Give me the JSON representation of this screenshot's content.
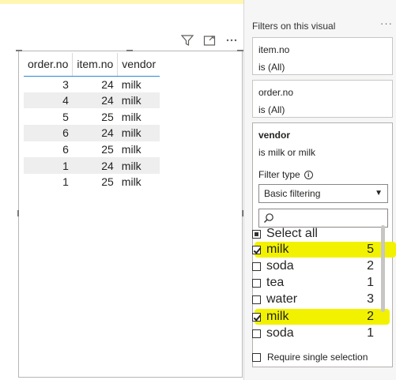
{
  "table": {
    "headers": [
      "order.no",
      "item.no",
      "vendor"
    ],
    "rows": [
      [
        "3",
        "24",
        "milk"
      ],
      [
        "4",
        "24",
        "milk"
      ],
      [
        "5",
        "25",
        "milk"
      ],
      [
        "6",
        "24",
        "milk"
      ],
      [
        "6",
        "25",
        "milk"
      ],
      [
        "1",
        "24",
        "milk"
      ],
      [
        "1",
        "25",
        "milk"
      ]
    ]
  },
  "visual_header": {
    "icons": [
      "filter-icon",
      "focus-mode-icon",
      "more-options-icon"
    ]
  },
  "filter_pane": {
    "title": "Filters on this visual",
    "more": "···",
    "cards": [
      {
        "field": "item.no",
        "summary": "is (All)"
      },
      {
        "field": "order.no",
        "summary": "is (All)"
      }
    ],
    "vendor_card": {
      "field": "vendor",
      "summary": "is milk or milk",
      "filter_type_label": "Filter type",
      "filter_type_value": "Basic filtering",
      "search_placeholder": "",
      "select_all": "Select all",
      "items": [
        {
          "label": "milk",
          "count": "5",
          "checked": true,
          "highlighted": true
        },
        {
          "label": "soda",
          "count": "2",
          "checked": false,
          "highlighted": false
        },
        {
          "label": "tea",
          "count": "1",
          "checked": false,
          "highlighted": false
        },
        {
          "label": "water",
          "count": "3",
          "checked": false,
          "highlighted": false
        },
        {
          "label": "milk",
          "count": "2",
          "checked": true,
          "highlighted": true
        },
        {
          "label": "soda",
          "count": "1",
          "checked": false,
          "highlighted": false
        }
      ],
      "require_single": "Require single selection"
    }
  },
  "colors": {
    "highlight": "#f2f200",
    "header_underline": "#2b88d8",
    "band_row": "#eeeeee"
  }
}
